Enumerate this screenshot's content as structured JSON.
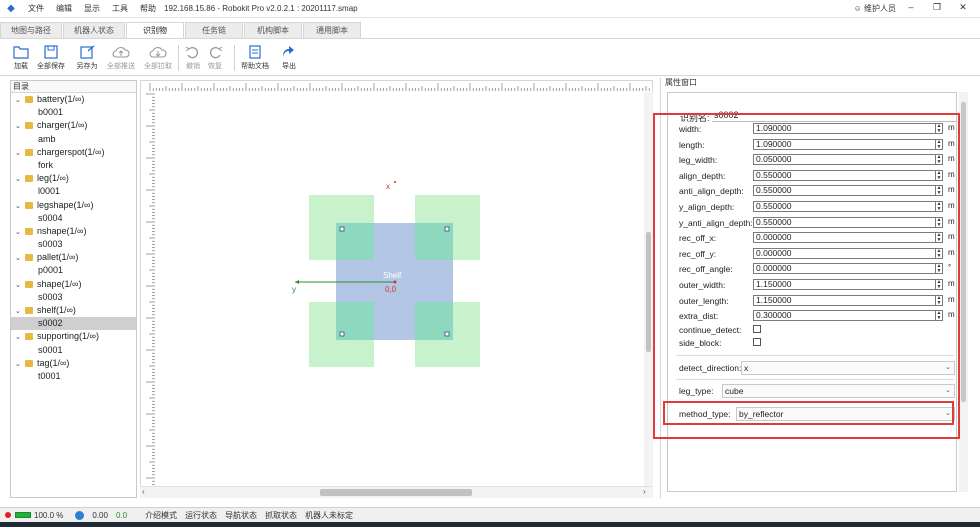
{
  "titlebar": {
    "menus": [
      "文件",
      "编辑",
      "显示",
      "工具",
      "帮助"
    ],
    "title": "192.168.15.86 - Robokit Pro v2.0.2.1 : 20201117.smap",
    "user": "维护人员",
    "minimize": "–",
    "maximize": "❐",
    "close": "✕"
  },
  "tabs": [
    {
      "label": "地图与路径",
      "active": false
    },
    {
      "label": "机器人状态",
      "active": false
    },
    {
      "label": "识别物",
      "active": true
    },
    {
      "label": "任务链",
      "active": false
    },
    {
      "label": "机构脚本",
      "active": false
    },
    {
      "label": "通用脚本",
      "active": false
    }
  ],
  "toolbar": {
    "buttons": [
      {
        "label": "加载",
        "icon": "folder-open-icon",
        "disabled": false
      },
      {
        "label": "全部保存",
        "icon": "save-icon",
        "disabled": false
      },
      {
        "label": "另存为",
        "icon": "save-as-icon",
        "disabled": false
      },
      {
        "label": "全部推送",
        "icon": "cloud-upload-icon",
        "disabled": true
      },
      {
        "label": "全部拉取",
        "icon": "cloud-download-icon",
        "disabled": true
      },
      {
        "label": "撤销",
        "icon": "undo-icon",
        "disabled": true
      },
      {
        "label": "恢复",
        "icon": "redo-icon",
        "disabled": true
      },
      {
        "label": "帮助文档",
        "icon": "help-doc-icon",
        "disabled": false
      },
      {
        "label": "导出",
        "icon": "export-icon",
        "disabled": false
      }
    ]
  },
  "tree": {
    "header": "目录",
    "groups": [
      {
        "name": "battery(1/∞)",
        "children": [
          "b0001"
        ]
      },
      {
        "name": "charger(1/∞)",
        "children": [
          "amb"
        ]
      },
      {
        "name": "chargerspot(1/∞)",
        "children": [
          "fork"
        ]
      },
      {
        "name": "leg(1/∞)",
        "children": [
          "l0001"
        ]
      },
      {
        "name": "legshape(1/∞)",
        "children": [
          "s0004"
        ]
      },
      {
        "name": "nshape(1/∞)",
        "children": [
          "s0003"
        ]
      },
      {
        "name": "pallet(1/∞)",
        "children": [
          "p0001"
        ]
      },
      {
        "name": "shape(1/∞)",
        "children": [
          "s0003"
        ]
      },
      {
        "name": "shelf(1/∞)",
        "children": [
          "s0002"
        ]
      },
      {
        "name": "supporting(1/∞)",
        "children": [
          "s0001"
        ]
      },
      {
        "name": "tag(1/∞)",
        "children": [
          "t0001"
        ]
      }
    ],
    "selected": "s0002"
  },
  "canvas": {
    "object_label": "Shelf",
    "origin_label": "0,0",
    "x_axis_label": "x",
    "y_axis_label": "y"
  },
  "attr": {
    "header": "属性窗口",
    "name_label": "识别名:",
    "name_value": "s0002",
    "params": [
      {
        "label": "width:",
        "value": "1.090000",
        "unit": "m"
      },
      {
        "label": "length:",
        "value": "1.090000",
        "unit": "m"
      },
      {
        "label": "leg_width:",
        "value": "0.050000",
        "unit": "m"
      },
      {
        "label": "align_depth:",
        "value": "0.550000",
        "unit": "m"
      },
      {
        "label": "anti_align_depth:",
        "value": "0.550000",
        "unit": "m"
      },
      {
        "label": "y_align_depth:",
        "value": "0.550000",
        "unit": "m"
      },
      {
        "label": "y_anti_align_depth:",
        "value": "0.550000",
        "unit": "m"
      },
      {
        "label": "rec_off_x:",
        "value": "0.000000",
        "unit": "m"
      },
      {
        "label": "rec_off_y:",
        "value": "0.000000",
        "unit": "m"
      },
      {
        "label": "rec_off_angle:",
        "value": "0.000000",
        "unit": "°"
      },
      {
        "label": "outer_width:",
        "value": "1.150000",
        "unit": "m"
      },
      {
        "label": "outer_length:",
        "value": "1.150000",
        "unit": "m"
      },
      {
        "label": "extra_dist:",
        "value": "0.300000",
        "unit": "m"
      }
    ],
    "checks": [
      {
        "label": "continue_detect:",
        "checked": false
      },
      {
        "label": "side_block:",
        "checked": false
      }
    ],
    "detect_direction": {
      "label": "detect_direction:",
      "value": "x"
    },
    "leg_type": {
      "label": "leg_type:",
      "value": "cube"
    },
    "method_type": {
      "label": "method_type:",
      "value": "by_reflector"
    }
  },
  "status": {
    "zoom": "100.0 %",
    "speed": "0.00",
    "rate": "0.0",
    "items": [
      "介绍模式",
      "运行状态",
      "导航状态",
      "抓取状态",
      "机器人未标定"
    ]
  },
  "colors": {
    "accent": "#2a6bd1",
    "highlight": "#e03a3a",
    "shelf_body": "#b4c6e6",
    "shelf_leg_zone": "#c8f2cc",
    "shelf_leg": "#8ed8bf",
    "axis": "#2e8b2e"
  }
}
